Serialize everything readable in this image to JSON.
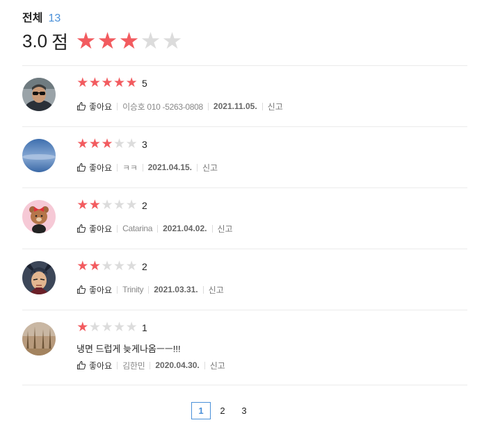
{
  "summary": {
    "total_label": "전체",
    "total_count": "13",
    "score": "3.0",
    "score_unit": "점",
    "rating": 3,
    "max_rating": 5
  },
  "colors": {
    "star_on": "#f25b5f",
    "star_off": "#dcdcdc",
    "accent": "#4a90d9"
  },
  "labels": {
    "like": "좋아요",
    "report": "신고"
  },
  "reviews": [
    {
      "rating": 5,
      "score": "5",
      "text": "",
      "author": "이승호 010 -5263-0808",
      "date": "2021.11.05.",
      "avatar": "person-with-sunglasses"
    },
    {
      "rating": 3,
      "score": "3",
      "text": "",
      "author": "ㅋㅋ",
      "date": "2021.04.15.",
      "avatar": "blue-sky-sea"
    },
    {
      "rating": 2,
      "score": "2",
      "text": "",
      "author": "Catarina",
      "date": "2021.04.02.",
      "avatar": "cartoon-bear"
    },
    {
      "rating": 2,
      "score": "2",
      "text": "",
      "author": "Trinity",
      "date": "2021.03.31.",
      "avatar": "anime-character"
    },
    {
      "rating": 1,
      "score": "1",
      "text": "냉면 드럽게 늦게나옴ㅡㅡ!!!",
      "author": "김한민",
      "date": "2020.04.30.",
      "avatar": "autumn-trees"
    }
  ],
  "pagination": {
    "pages": [
      "1",
      "2",
      "3"
    ],
    "current": "1"
  }
}
